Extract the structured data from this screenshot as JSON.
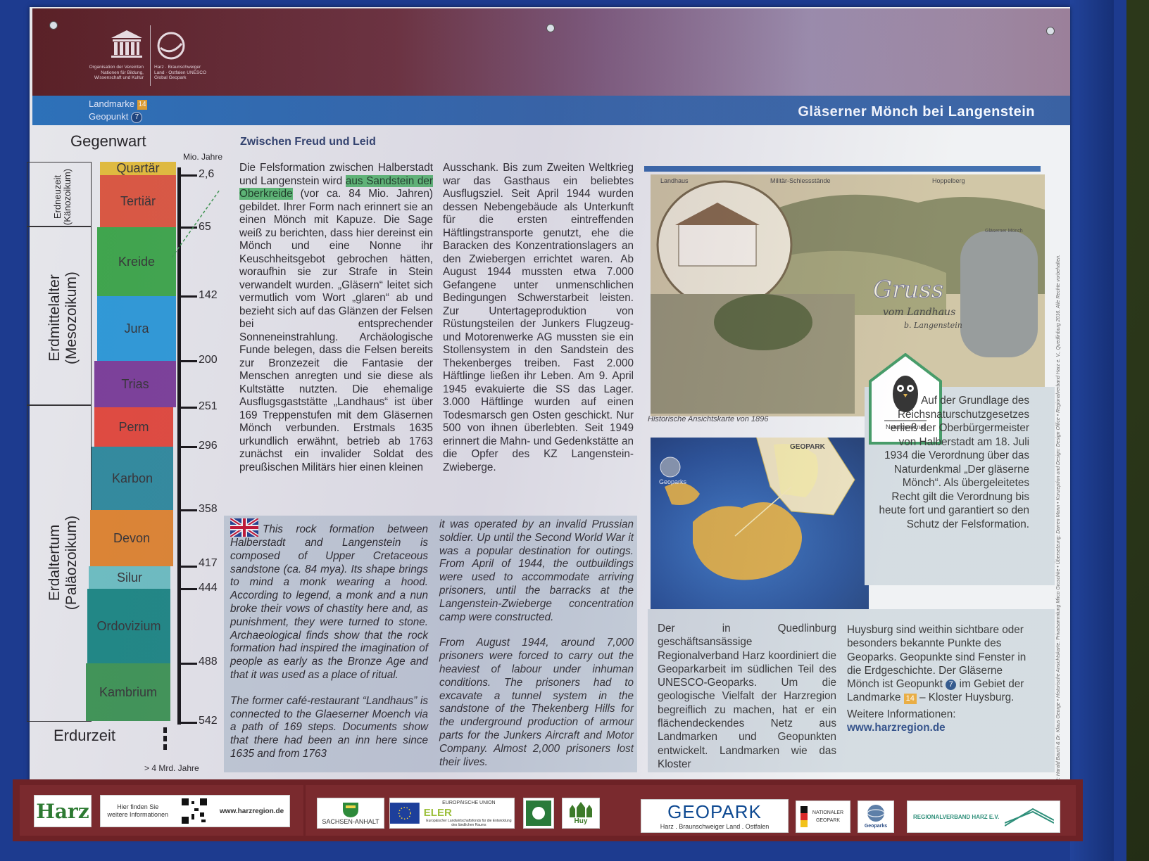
{
  "header": {
    "unesco_text": "Organisation der Vereinten Nationen für Bildung, Wissenschaft und Kultur",
    "geopark_text": "Harz · Braunschweiger Land · Ostfalen UNESCO Global Geopark",
    "landmarke_label": "Landmarke",
    "landmarke_number": "14",
    "geopunkt_label": "Geopunkt",
    "geopunkt_number": "7",
    "title": "Gläserner Mönch bei Langenstein"
  },
  "timeline": {
    "top_label": "Gegenwart",
    "unit_label": "Mio. Jahre",
    "bottom_label": "Erdurzeit",
    "bottom_age": "> 4 Mrd. Jahre",
    "eras": [
      {
        "name": "Erdneuzeit",
        "sub": "(Känozoikum)"
      },
      {
        "name": "Erdmittelalter",
        "sub": "(Mesozoikum)"
      },
      {
        "name": "Erdaltertum",
        "sub": "(Paläozoikum)"
      }
    ],
    "periods": [
      {
        "name": "Quartär",
        "color": "#e9c33a"
      },
      {
        "name": "Tertiär",
        "color": "#e2593f"
      },
      {
        "name": "Kreide",
        "color": "#3dac4a"
      },
      {
        "name": "Jura",
        "color": "#2c9fde"
      },
      {
        "name": "Trias",
        "color": "#7e3f9c"
      },
      {
        "name": "Perm",
        "color": "#e94a3b"
      },
      {
        "name": "Karbon",
        "color": "#2e8fa1"
      },
      {
        "name": "Devon",
        "color": "#e6892e"
      },
      {
        "name": "Silur",
        "color": "#6ec6c7"
      },
      {
        "name": "Ordovizium",
        "color": "#1a8c86"
      },
      {
        "name": "Kambrium",
        "color": "#3d9a54"
      }
    ],
    "ticks": [
      "2,6",
      "65",
      "142",
      "200",
      "251",
      "296",
      "358",
      "417",
      "444",
      "488",
      "542"
    ]
  },
  "article": {
    "title": "Zwischen Freud und Leid",
    "de_col1_pre": "Die Felsformation zwischen Halberstadt und Langenstein wird",
    "de_col1_highlight": "aus Sandstein der Oberkreide",
    "de_col1_post": "(vor ca. 84 Mio. Jahren) gebildet. Ihrer Form nach erinnert sie an einen Mönch mit Kapuze. Die Sage weiß zu berichten, dass hier dereinst ein Mönch und eine Nonne ihr Keuschheitsgebot gebrochen hätten, woraufhin sie zur Strafe in Stein verwandelt wurden. „Gläsern“ leitet sich vermutlich vom Wort „glaren“ ab und bezieht sich auf das Glänzen der Felsen bei entsprechender Sonneneinstrahlung. Archäologische Funde belegen, dass die Felsen bereits zur Bronzezeit die Fantasie der Menschen anregten und sie diese als Kultstätte nutzten. Die ehemalige Ausflugsgaststätte „Landhaus“ ist über 169 Treppenstufen mit dem Gläsernen Mönch verbunden. Erstmals 1635 urkundlich erwähnt, betrieb ab 1763 zunächst ein invalider Soldat des preußischen Militärs hier einen kleinen",
    "de_col2": "Ausschank. Bis zum Zweiten Weltkrieg war das Gasthaus ein beliebtes Ausflugsziel. Seit April 1944 wurden dessen Nebengebäude als Unterkunft für die ersten eintreffenden Häftlingstransporte genutzt, ehe die Baracken des Konzentrationslagers an den Zwiebergen errichtet waren. Ab August 1944 mussten etwa 7.000 Gefangene unter unmenschlichen Bedingungen Schwerstarbeit leisten. Zur Untertageproduktion von Rüstungsteilen der Junkers Flugzeug- und Motorenwerke AG mussten sie ein Stollensystem in den Sandstein des Thekenberges treiben. Fast 2.000 Häftlinge ließen ihr Leben. Am 9. April 1945 evakuierte die SS das Lager. 3.000 Häftlinge wurden auf einen Todesmarsch gen Osten geschickt. Nur 500 von ihnen überlebten. Seit 1949 erinnert die Mahn- und Gedenkstätte an die Opfer des KZ Langenstein-Zwieberge.",
    "en_col1_p1": "This rock formation between Halberstadt and Langenstein is composed of Upper Cretaceous sandstone (ca. 84 mya). Its shape brings to mind a monk wearing a hood. According to legend, a monk and a nun broke their vows of chastity here and, as punishment, they were turned to stone. Archaeological finds show that the rock formation had inspired the imagination of people as early as the Bronze Age and that it was used as a place of ritual.",
    "en_col1_p2": "The former café-restaurant “Landhaus” is connected to the Glaeserner Moench via a path of 169 steps. Documents show that there had been an inn here since 1635 and from 1763",
    "en_col2_p1": "it was operated by an invalid Prussian soldier. Up until the Second World War it was a popular destination for outings. From April of 1944, the outbuildings were used to accommodate arriving prisoners, until the barracks at the Langenstein-Zwieberge concentration camp were constructed.",
    "en_col2_p2": "From August 1944, around 7,000 prisoners were forced to carry out the heaviest of labour under inhuman conditions. The prisoners had to excavate a tunnel system in the sandstone of the Thekenberg Hills for the underground production of armour parts for the Junkers Aircraft and Motor Company. Almost 2,000 prisoners lost their lives."
  },
  "postcard": {
    "caption": "Historische Ansichtskarte von 1896",
    "labels": [
      "Landhaus",
      "Militär-Schiessstände",
      "Hoppelberg",
      "Gläserner Mönch",
      "Gruss",
      "vom Landhaus",
      "b. Langenstein"
    ]
  },
  "map": {
    "geoparks_label": "Geoparks",
    "region_label": "GEOPARK"
  },
  "naturdenkmal": {
    "label": "Naturdenkmal",
    "text": "Auf der Grundlage des Reichsnaturschutzgesetzes erließ der Oberbürgermeister von Halberstadt am 18. Juli 1934 die Verordnung über das Naturdenkmal „Der gläserne Mönch“. Als übergeleitetes Recht gilt die Verordnung bis heute fort und garantiert so den Schutz der Felsformation."
  },
  "regional": {
    "col1": "Der in Quedlinburg geschäftsansässige Regionalverband Harz koordiniert die Geoparkarbeit im südlichen Teil des UNESCO-Geoparks. Um die geologische Vielfalt der Harzregion begreiflich zu machen, hat er ein flächendeckendes Netz aus Landmarken und Geopunkten entwickelt. Landmarken wie das Kloster",
    "col2_pre": "Huysburg sind weithin sichtbare oder besonders bekannte Punkte des Geoparks. Geopunkte sind Fenster in die Erdgeschichte. Der Gläserne Mönch ist Geopunkt",
    "col2_geo": "7",
    "col2_mid": "im Gebiet der Landmarke",
    "col2_lm": "14",
    "col2_post": "– Kloster Huysburg.",
    "more_info": "Weitere Informationen:",
    "url": "www.harzregion.de"
  },
  "credits": "Text: Harald Bauch & Dr. Klaus George • Historische Ansichtskarte: Privatsammlung Mirco Gruschke • Übersetzung: Darren Mann • Konzeption und Design: Design Office • Regionalverband Harz e. V., Quedlinburg 2016. Alle Rechte vorbehalten.",
  "footer": {
    "harz": "Harz",
    "qr_text": "Hier finden Sie weitere Informationen",
    "qr_url": "www.harzregion.de",
    "sachsen": "SACHSEN-ANHALT",
    "eu_top": "EUROPÄISCHE UNION",
    "eler": "ELER",
    "eler_sub": "Europäischer Landwirtschaftsfonds für die Entwicklung des ländlichen Raums",
    "huy": "Huy",
    "geopark": "GEOPARK",
    "geopark_sub": "Harz . Braunschweiger Land . Ostfalen",
    "national_geopark": "NATIONALER GEOPARK",
    "geoparks": "Geoparks",
    "regionalverband": "REGIONALVERBAND HARZ E.V."
  }
}
